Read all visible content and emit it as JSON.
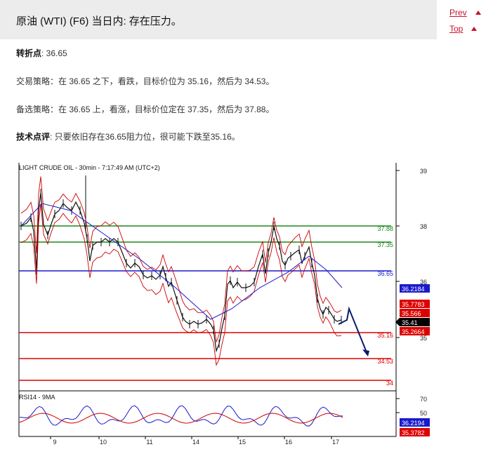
{
  "header": {
    "title": "原油 (WTI) (F6) 当日内: 存在压力。"
  },
  "nav": {
    "prev_label": "Prev",
    "top_label": "Top"
  },
  "content": {
    "pivot_label": "转折点",
    "pivot_value": ": 36.65",
    "strategy_label": "交易策略",
    "strategy_text": "：在 36.65 之下，看跌，目标价位为 35.16，然后为 34.53。",
    "alternative_label": "备选策略",
    "alternative_text": "：在 36.65 上，看涨，目标价位定在 37.35，然后为 37.88。",
    "comment_label": "技术点评",
    "comment_text": ": 只要依旧存在36.65阻力位，很可能下跌至35.16。"
  },
  "chart": {
    "title": "LIGHT CRUDE OIL - 30min - 7:17:49 AM (UTC+2)",
    "rsi_title": "RSI14 - 9MA",
    "price_ticks": [
      "39",
      "38",
      "36",
      "35"
    ],
    "rsi_ticks": [
      "70",
      "50"
    ],
    "x_labels": [
      "9",
      "10",
      "11",
      "14",
      "15",
      "16",
      "17"
    ],
    "levels": [
      {
        "value": 37.88,
        "label": "37.88",
        "color": "#1a8a1a"
      },
      {
        "value": 37.35,
        "label": "37.35",
        "color": "#1a8a1a"
      },
      {
        "value": 36.65,
        "label": "36.65",
        "color": "#1a1acc"
      },
      {
        "value": 35.16,
        "label": "35.16",
        "color": "#dd0000"
      },
      {
        "value": 34.53,
        "label": "34.53",
        "color": "#dd0000"
      },
      {
        "value": 34,
        "label": "34",
        "color": "#dd0000"
      }
    ],
    "price_badges": [
      {
        "label": "36.2184",
        "bg": "#1a1acc"
      },
      {
        "label": "35.7783",
        "bg": "#dd0000"
      },
      {
        "label": "35.566",
        "bg": "#dd0000"
      },
      {
        "label": "35.41",
        "bg": "#000000"
      },
      {
        "label": "35.2664",
        "bg": "#dd0000"
      }
    ],
    "rsi_badges": [
      {
        "label": "36.2194",
        "bg": "#1a1acc"
      },
      {
        "label": "35.3782",
        "bg": "#dd0000"
      }
    ]
  }
}
